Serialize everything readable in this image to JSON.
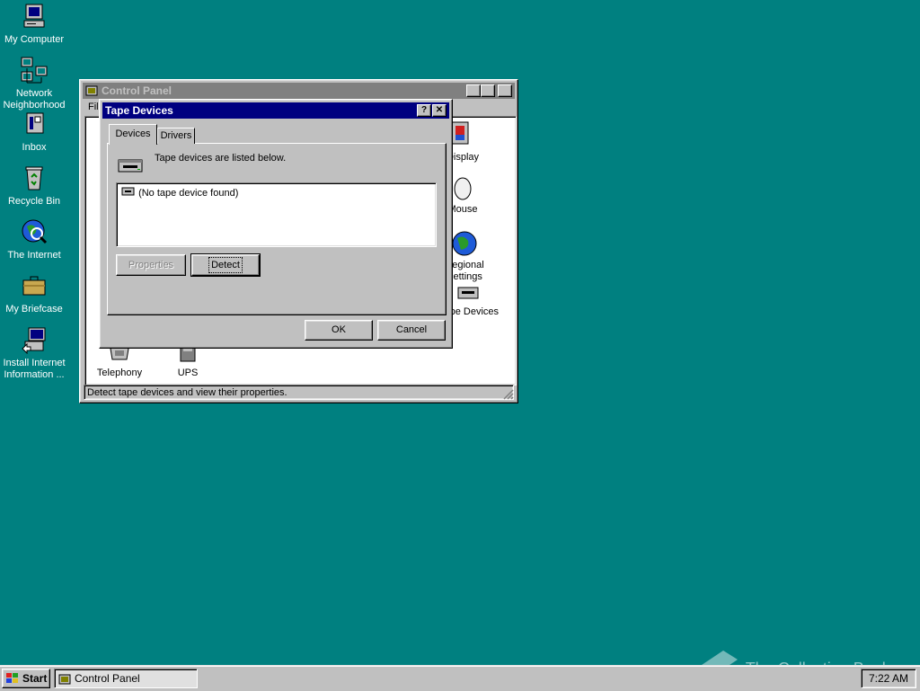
{
  "desktop": {
    "icons": [
      {
        "label": "My Computer",
        "icon": "computer-icon"
      },
      {
        "label": "Network Neighborhood",
        "icon": "network-icon"
      },
      {
        "label": "Inbox",
        "icon": "inbox-icon"
      },
      {
        "label": "Recycle Bin",
        "icon": "recycle-bin-icon"
      },
      {
        "label": "The Internet",
        "icon": "internet-icon"
      },
      {
        "label": "My Briefcase",
        "icon": "briefcase-icon"
      },
      {
        "label": "Install Internet Information ...",
        "icon": "install-icon"
      }
    ]
  },
  "control_panel": {
    "title": "Control Panel",
    "menu_first": "File",
    "items_visible": [
      "Telephony",
      "UPS",
      "Display",
      "Mouse",
      "Regional Settings",
      "Tape Devices"
    ],
    "status": "Detect tape devices and view their properties."
  },
  "dialog": {
    "title": "Tape Devices",
    "help_label": "?",
    "close_label": "✕",
    "tabs": [
      "Devices",
      "Drivers"
    ],
    "description": "Tape devices are listed below.",
    "list": [
      "(No tape device found)"
    ],
    "properties_label": "Properties",
    "detect_label": "Detect",
    "ok_label": "OK",
    "cancel_label": "Cancel"
  },
  "taskbar": {
    "start_label": "Start",
    "task_label": "Control Panel",
    "clock": "7:22 AM"
  },
  "watermark": "The Collection Book",
  "colors": {
    "desktop": "#008080",
    "title_active": "#000080",
    "title_inactive": "#808080"
  }
}
